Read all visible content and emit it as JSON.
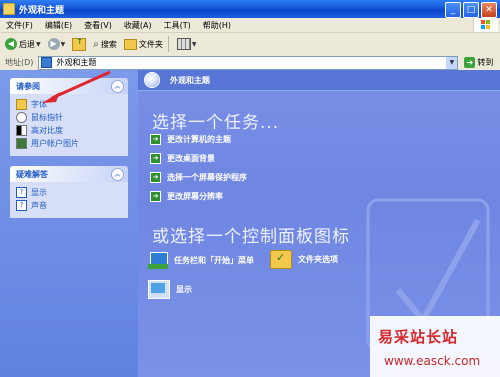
{
  "window": {
    "title": "外观和主题"
  },
  "menubar": {
    "items": [
      "文件(F)",
      "编辑(E)",
      "查看(V)",
      "收藏(A)",
      "工具(T)",
      "帮助(H)"
    ]
  },
  "toolbar": {
    "back_label": "后退",
    "search_label": "搜索",
    "folders_label": "文件夹"
  },
  "addressbar": {
    "label": "地址(D)",
    "value": "外观和主题",
    "go_label": "转到"
  },
  "sidebar": {
    "see_also": {
      "title": "请参阅",
      "items": [
        "字体",
        "鼠标指针",
        "高对比度",
        "用户帐户图片"
      ]
    },
    "troubleshoot": {
      "title": "疑难解答",
      "items": [
        "显示",
        "声音"
      ]
    }
  },
  "main": {
    "header_title": "外观和主题",
    "task_heading": "选择一个任务...",
    "tasks": [
      "更改计算机的主题",
      "更改桌面背景",
      "选择一个屏幕保护程序",
      "更改屏幕分辨率"
    ],
    "icon_heading": "或选择一个控制面板图标",
    "icons": [
      "任务栏和「开始」菜单",
      "文件夹选项",
      "显示"
    ]
  },
  "watermark": {
    "text": "易采站长站",
    "url": "www.easck.com"
  },
  "colors": {
    "annotation_arrow": "#e0262e",
    "link": "#215dc6",
    "content_bg": "#6f86e2"
  }
}
